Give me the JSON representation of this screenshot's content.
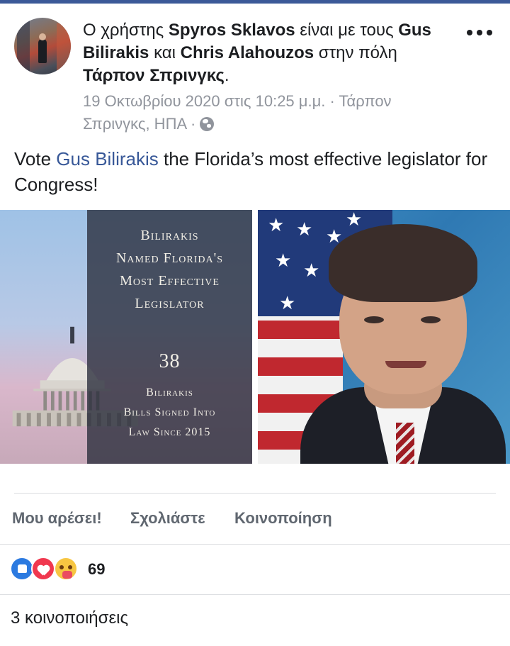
{
  "post": {
    "author_prefix": "Ο χρήστης",
    "author": "Spyros Sklavos",
    "with_text": "είναι με τους",
    "tagged_1": "Gus Bilirakis",
    "and_text": "και",
    "tagged_2": "Chris Alahouzos",
    "location_prefix": "στην πόλη",
    "location": "Τάρπον Σπρινγκς",
    "period": ".",
    "timestamp": "19 Οκτωβρίου 2020 στις 10:25 μ.μ.",
    "place": "Τάρπον Σπρινγκς, ΗΠΑ",
    "separator": " · ",
    "privacy_icon": "globe-icon",
    "more_icon": "more-options-icon",
    "text_before_link": "Vote ",
    "text_link": "Gus Bilirakis",
    "text_after_link": " the Florida’s most effective legislator for Congress!"
  },
  "image_left": {
    "line1": "Bilirakis",
    "line2": "Named Florida's",
    "line3": "Most Effective",
    "line4": "Legislator",
    "number": "38",
    "line5": "Bilirakis",
    "line6": "Bills Signed Into",
    "line7": "Law Since 2015"
  },
  "actions": {
    "like": "Μου αρέσει!",
    "comment": "Σχολιάστε",
    "share": "Κοινοποίηση"
  },
  "reactions": {
    "icons": [
      "like-icon",
      "love-icon",
      "care-icon"
    ],
    "count": "69"
  },
  "shares": {
    "label": "3 κοινοποιήσεις"
  },
  "colors": {
    "brand": "#3b5998",
    "link": "#385898",
    "meta": "#90949c",
    "action": "#606770"
  }
}
